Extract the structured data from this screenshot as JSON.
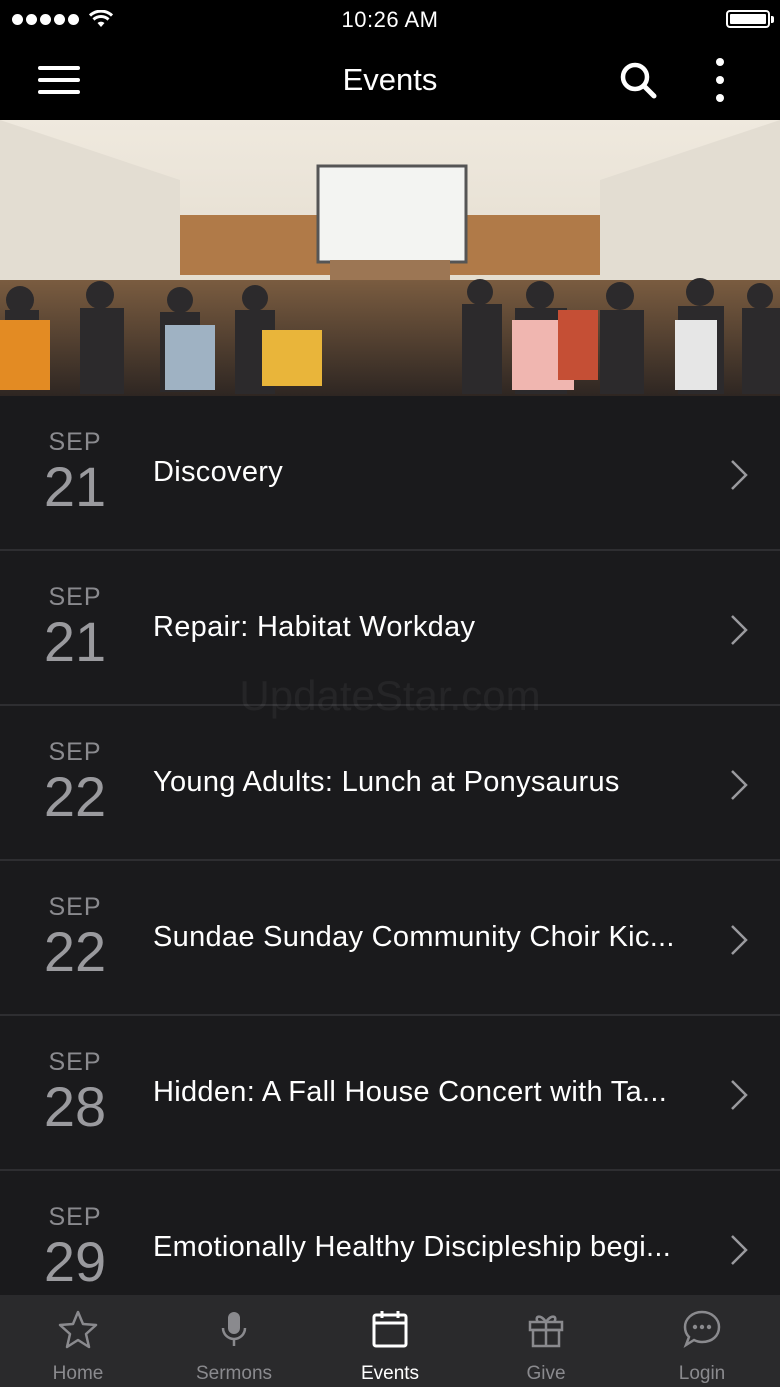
{
  "status_bar": {
    "time": "10:26 AM"
  },
  "header": {
    "title": "Events"
  },
  "watermark": "UpdateStar.com",
  "events": [
    {
      "month": "SEP",
      "day": "21",
      "title": "Discovery"
    },
    {
      "month": "SEP",
      "day": "21",
      "title": "Repair: Habitat Workday"
    },
    {
      "month": "SEP",
      "day": "22",
      "title": "Young Adults: Lunch at Ponysaurus"
    },
    {
      "month": "SEP",
      "day": "22",
      "title": "Sundae Sunday Community Choir Kic..."
    },
    {
      "month": "SEP",
      "day": "28",
      "title": "Hidden: A Fall House Concert with Ta..."
    },
    {
      "month": "SEP",
      "day": "29",
      "title": "Emotionally Healthy Discipleship begi..."
    }
  ],
  "tabs": [
    {
      "label": "Home",
      "icon": "star-icon"
    },
    {
      "label": "Sermons",
      "icon": "microphone-icon"
    },
    {
      "label": "Events",
      "icon": "calendar-icon",
      "active": true
    },
    {
      "label": "Give",
      "icon": "gift-icon"
    },
    {
      "label": "Login",
      "icon": "chat-bubble-icon"
    }
  ],
  "colors": {
    "background": "#1a1a1c",
    "bar": "#000000",
    "tab_bar": "#2a2a2c",
    "muted": "#8a8a8e"
  }
}
